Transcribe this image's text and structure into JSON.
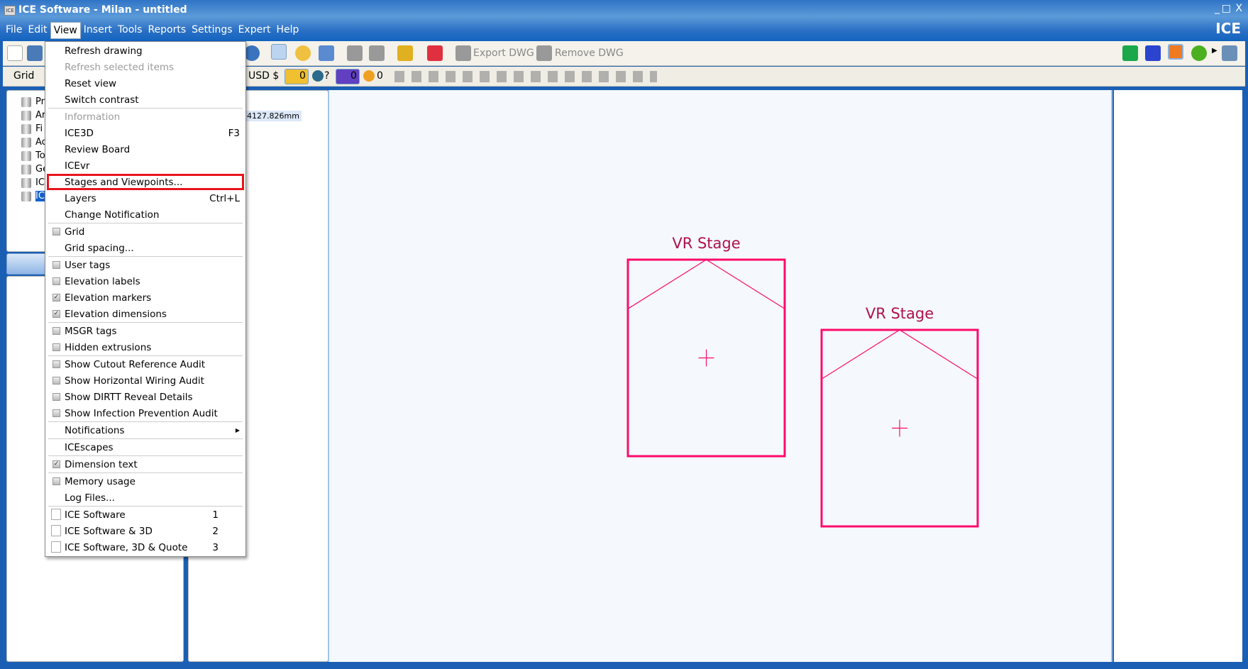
{
  "window": {
    "title": "ICE Software - Milan - untitled",
    "icon_text": "ICE",
    "brand": "ICE",
    "controls": [
      "_",
      "□",
      "X"
    ]
  },
  "menubar": [
    "File",
    "Edit",
    "View",
    "Insert",
    "Tools",
    "Reports",
    "Settings",
    "Expert",
    "Help"
  ],
  "toolbar1": {
    "export_dwg": "Export DWG",
    "remove_dwg": "Remove DWG",
    "right_icons": [
      "s-cube-icon",
      "vr-cube-icon",
      "orange-cube-icon",
      "dollar-icon",
      "monitor-icon"
    ]
  },
  "toolbar2": {
    "grid": "Grid",
    "currency": "USD $",
    "count1": "0",
    "count2": "?",
    "count3": "0",
    "count4": "0"
  },
  "tree": [
    "Pr",
    "Ar",
    "Fi",
    "Ac",
    "To",
    "Ge",
    "IC",
    "IC"
  ],
  "coordinate": "4127.826mm",
  "view_menu": [
    {
      "label": "Refresh drawing"
    },
    {
      "label": "Refresh selected items",
      "disabled": true
    },
    {
      "label": "Reset view"
    },
    {
      "label": "Switch contrast"
    },
    {
      "sep": true
    },
    {
      "label": "Information",
      "disabled": true
    },
    {
      "label": "ICE3D",
      "shortcut": "F3"
    },
    {
      "label": "Review Board"
    },
    {
      "label": "ICEvr"
    },
    {
      "label": "Stages and Viewpoints...",
      "highlight": true
    },
    {
      "label": "Layers",
      "shortcut": "Ctrl+L"
    },
    {
      "label": "Change Notification"
    },
    {
      "sep": true
    },
    {
      "label": "Grid",
      "check": false
    },
    {
      "label": "Grid spacing..."
    },
    {
      "sep": true
    },
    {
      "label": "User tags",
      "check": false
    },
    {
      "label": "Elevation labels",
      "check": false
    },
    {
      "label": "Elevation markers",
      "check": true
    },
    {
      "label": "Elevation dimensions",
      "check": true
    },
    {
      "sep": true
    },
    {
      "label": "MSGR tags",
      "check": false
    },
    {
      "label": "Hidden extrusions",
      "check": false
    },
    {
      "sep": true
    },
    {
      "label": "Show Cutout Reference Audit",
      "check": false
    },
    {
      "label": "Show Horizontal Wiring Audit",
      "check": false
    },
    {
      "label": "Show DIRTT Reveal Details",
      "check": false
    },
    {
      "label": "Show Infection Prevention Audit",
      "check": false
    },
    {
      "sep": true
    },
    {
      "label": "Notifications",
      "submenu": true
    },
    {
      "sep": true
    },
    {
      "label": "ICEscapes"
    },
    {
      "sep": true
    },
    {
      "label": "Dimension text",
      "check": true
    },
    {
      "sep": true
    },
    {
      "label": "Memory usage",
      "check": false
    },
    {
      "label": "Log Files..."
    },
    {
      "sep": true
    },
    {
      "label": "ICE Software",
      "layout": true,
      "num": "1"
    },
    {
      "label": "ICE Software & 3D",
      "layout": true,
      "num": "2"
    },
    {
      "label": "ICE Software, 3D & Quote",
      "layout": true,
      "num": "3"
    }
  ],
  "stages": [
    {
      "label": "VR Stage"
    },
    {
      "label": "VR Stage"
    }
  ],
  "colors": {
    "stage": "#ff0a6c",
    "stage_label": "#b0104f",
    "highlight": "#e8141c",
    "titlebar": "#2a6fc4"
  }
}
